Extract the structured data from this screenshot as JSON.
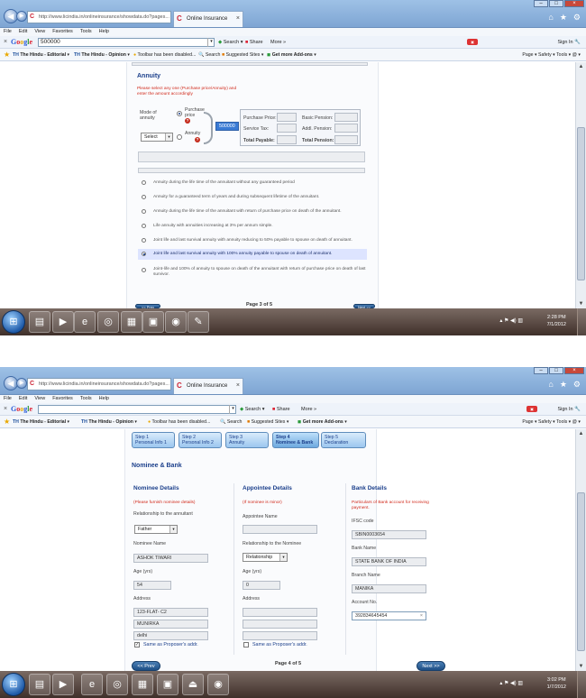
{
  "screenshot1": {
    "browser": {
      "address": "http://www.licindia.in/onlineinsurance/showdata.do?pages...",
      "tab_title": "Online Insurance",
      "menu": [
        "File",
        "Edit",
        "View",
        "Favorites",
        "Tools",
        "Help"
      ],
      "google_query": "500000",
      "search_label": "Search",
      "share_label": "Share",
      "more_label": "More »",
      "signin_label": "Sign In",
      "favbar_items": [
        "The Hindu - Editorial",
        "The Hindu - Opinion",
        "Toolbar has been disabled...",
        "Search",
        "Suggested Sites",
        "Get more Add-ons"
      ],
      "cmdbar": "Page ▾  Safety ▾  Tools ▾  @ ▾"
    },
    "annuity": {
      "title": "Annuity",
      "note": "Please select any one (Purchase price/Annuity) and enter the amount accordingly",
      "mode_label": "Mode of annuity",
      "mode_select": "Select",
      "purchase_price_label": "Purchase price",
      "purchase_value": "500000",
      "annuity_label": "Annuity",
      "calc_labels": [
        "Purchase Price:",
        "Service Tax:",
        "Total Payable:",
        "Basic Pension:",
        "Addl. Pension:",
        "Total Pension:"
      ],
      "options": [
        "Annuity during the life time of the annuitant without any guaranteed period",
        "Annuity for a guaranteed term of years and during subsequent lifetime of the annuitant.",
        "Annuity during the life time of the annuitant with return of purchase price on death of the annuitant.",
        "Life annuity with annuities increasing at 3% per annum simple.",
        "Joint life and last survival annuity with annuity reducing to 50% payable to spouse on death of annuitant.",
        "Joint life and last survival annuity with 100% annuity payable to spouse on death of annuitant.",
        "Joint-life and 100% of annuity to spouse on death of the annuitant with return of purchase price on death of last survivor."
      ],
      "selected_option_index": 5,
      "prev_label": "<< Prev",
      "page_label": "Page 3 of 5",
      "next_label": "Next >>"
    },
    "clock": {
      "time": "2:28 PM",
      "date": "7/1/2012"
    }
  },
  "screenshot2": {
    "browser": {
      "address": "http://www.licindia.in/onlineinsurance/showdata.do?pages...",
      "tab_title": "Online Insurance",
      "menu": [
        "File",
        "Edit",
        "View",
        "Favorites",
        "Tools",
        "Help"
      ],
      "google_query": "",
      "search_label": "Search",
      "share_label": "Share",
      "more_label": "More »",
      "signin_label": "Sign In",
      "favbar_items": [
        "The Hindu - Editorial",
        "The Hindu - Opinion",
        "Toolbar has been disabled...",
        "Search",
        "Suggested Sites",
        "Get more Add-ons"
      ],
      "cmdbar": "Page ▾  Safety ▾  Tools ▾  @ ▾"
    },
    "steps": [
      {
        "num": "Step 1",
        "name": "Personal Info 1"
      },
      {
        "num": "Step 2",
        "name": "Personal Info 2"
      },
      {
        "num": "Step 3",
        "name": "Annuity"
      },
      {
        "num": "Step 4",
        "name": "Nominee & Bank"
      },
      {
        "num": "Step 5",
        "name": "Declaration"
      }
    ],
    "section_title": "Nominee & Bank",
    "nominee": {
      "title": "Nominee Details",
      "note": "(Please furnish nominee details)",
      "relationship_label": "Relationship to the annuitant",
      "relationship_value": "Father",
      "name_label": "Nominee Name",
      "name_value": "ASHOK TIWARI",
      "age_label": "Age (yrs)",
      "age_value": "54",
      "address_label": "Address",
      "address_lines": [
        "123-FLAT- C2",
        "MUNIRKA",
        "delhi"
      ],
      "same_as_label": "Same as Proposer's addr."
    },
    "appointee": {
      "title": "Appointee Details",
      "note": "(If nominee is minor)",
      "name_label": "Appointee Name",
      "relationship_label": "Relationship to the Nominee",
      "relationship_value": "Relationship",
      "age_label": "Age (yrs)",
      "age_value": "0",
      "address_label": "Address",
      "same_as_label": "Same as Proposer's addr."
    },
    "bank": {
      "title": "Bank Details",
      "note": "Particulars of Bank account for receiving payment.",
      "ifsc_label": "IFSC code",
      "ifsc_value": "SBIN0003654",
      "bank_label": "Bank Name",
      "bank_value": "STATE BANK OF INDIA",
      "branch_label": "Branch Name",
      "branch_value": "MANIKA",
      "account_label": "Account No.",
      "account_value": "392834645454"
    },
    "prev_label": "<< Prev",
    "page_label": "Page 4 of 5",
    "next_label": "Next >>",
    "clock": {
      "time": "3:02 PM",
      "date": "1/7/2012"
    }
  }
}
